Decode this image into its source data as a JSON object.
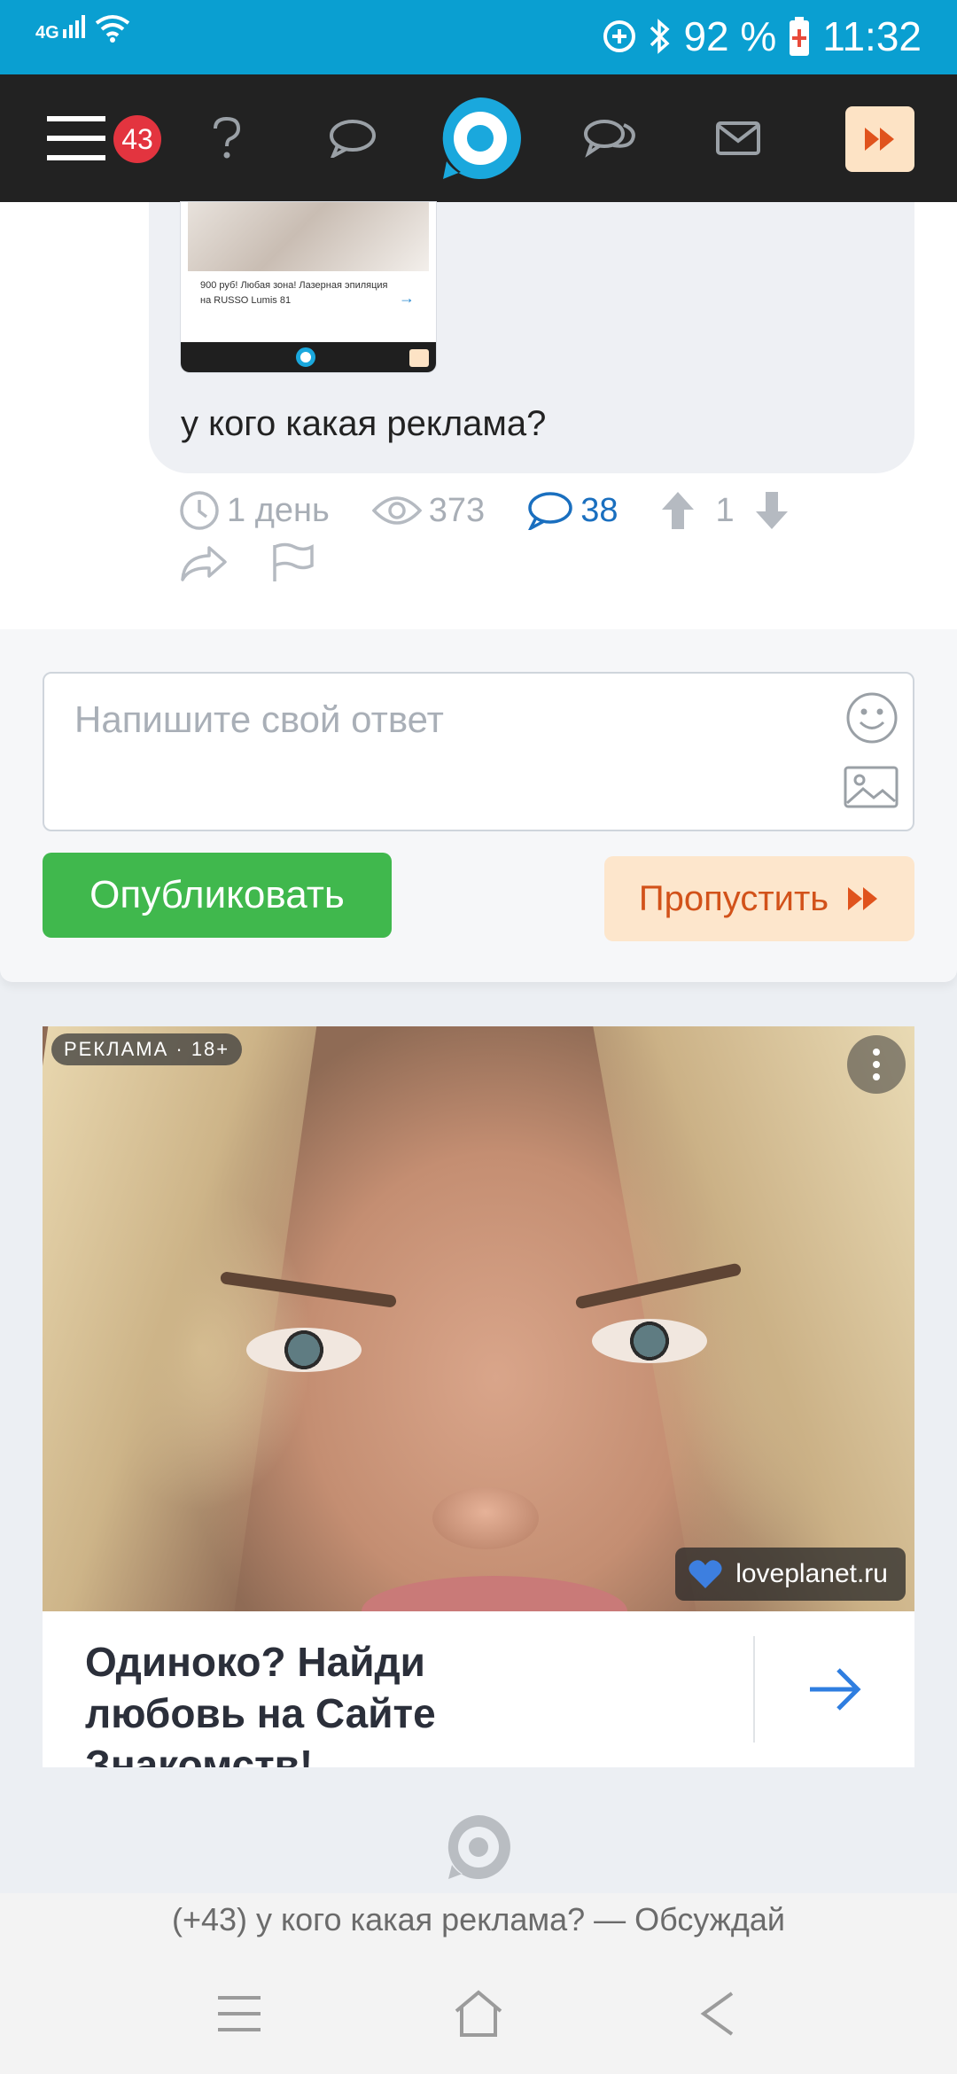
{
  "status_bar": {
    "network": "4G",
    "battery": "92 %",
    "time": "11:32"
  },
  "header": {
    "notifications_count": "43"
  },
  "post": {
    "thumbnail_caption": "900 руб! Любая зона! Лазерная эпиляция на RUSSO Lumis 81",
    "question": "у кого какая реклама?",
    "time": "1 день",
    "views": "373",
    "comments": "38",
    "rating": "1"
  },
  "reply": {
    "placeholder": "Напишите свой ответ",
    "publish_label": "Опубликовать",
    "skip_label": "Пропустить"
  },
  "ad": {
    "label": "РЕКЛАМА · 18+",
    "domain": "loveplanet.ru",
    "headline": "Одиноко? Найди любовь на Сайте Знакомств!"
  },
  "browser": {
    "url_title": "(+43) у кого какая реклама? — Обсуждай"
  },
  "colors": {
    "status_bar": "#0a9fd1",
    "app_bar": "#222222",
    "accent_blue": "#1a6fbf",
    "publish_green": "#40b84d",
    "skip_orange": "#d2521a"
  },
  "icons": [
    "menu-icon",
    "help-icon",
    "chat-bubble-icon",
    "logo-icon",
    "discussions-icon",
    "mail-icon",
    "fast-forward-icon",
    "clock-icon",
    "eye-icon",
    "comment-icon",
    "upvote-icon",
    "downvote-icon",
    "share-icon",
    "flag-icon",
    "emoji-icon",
    "image-icon",
    "more-icon",
    "arrow-right-icon",
    "home-icon",
    "back-icon",
    "recents-icon"
  ]
}
